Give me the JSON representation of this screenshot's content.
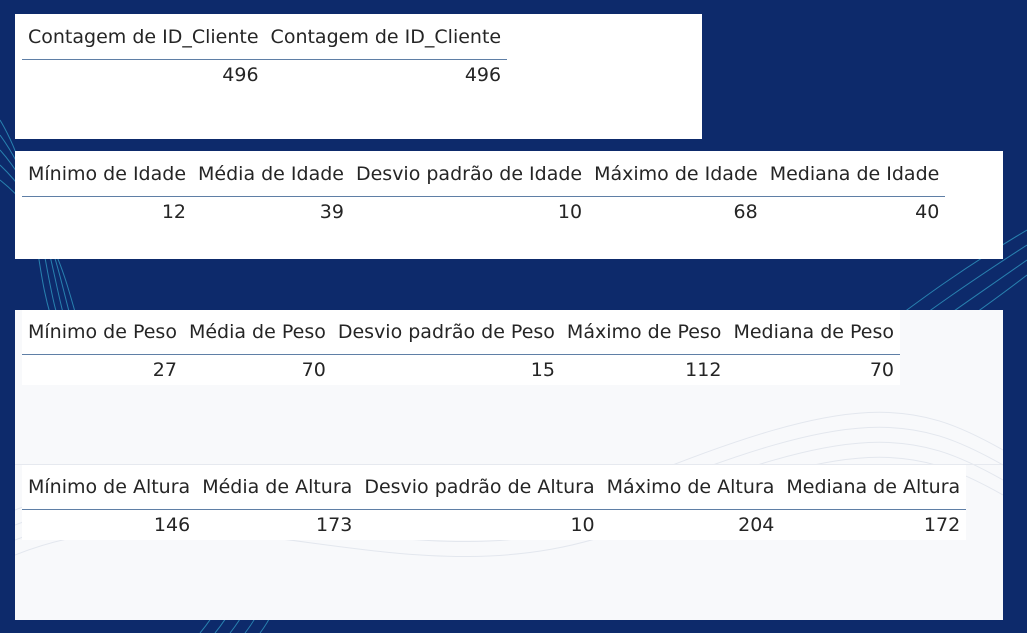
{
  "tables": {
    "clientes": {
      "headers": [
        "Contagem de ID_Cliente",
        "Contagem de ID_Cliente"
      ],
      "values": [
        "496",
        "496"
      ]
    },
    "idade": {
      "headers": [
        "Mínimo de Idade",
        "Média de Idade",
        "Desvio padrão de Idade",
        "Máximo de Idade",
        "Mediana de Idade"
      ],
      "values": [
        "12",
        "39",
        "10",
        "68",
        "40"
      ]
    },
    "peso": {
      "headers": [
        "Mínimo de Peso",
        "Média de Peso",
        "Desvio padrão de Peso",
        "Máximo de Peso",
        "Mediana de Peso"
      ],
      "values": [
        "27",
        "70",
        "15",
        "112",
        "70"
      ]
    },
    "altura": {
      "headers": [
        "Mínimo de Altura",
        "Média de Altura",
        "Desvio padrão de Altura",
        "Máximo de Altura",
        "Mediana de Altura"
      ],
      "values": [
        "146",
        "173",
        "10",
        "204",
        "172"
      ]
    }
  },
  "colors": {
    "background": "#0d2a6b",
    "wave_accent": "#3fc9e8",
    "panel": "#ffffff",
    "header_rule": "#5f7fa6",
    "text": "#252525"
  }
}
